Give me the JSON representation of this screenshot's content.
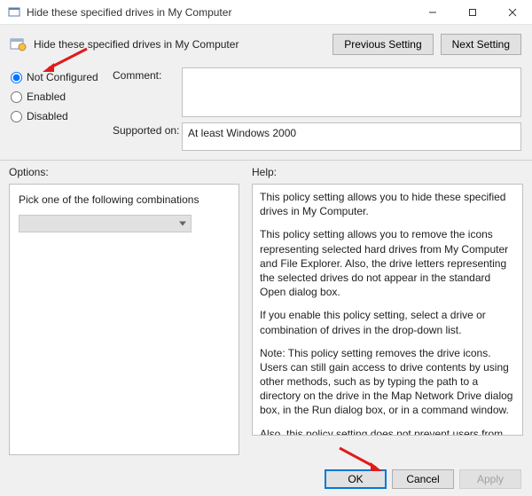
{
  "titlebar": {
    "title": "Hide these specified drives in My Computer"
  },
  "header": {
    "title": "Hide these specified drives in My Computer",
    "prev_btn": "Previous Setting",
    "next_btn": "Next Setting"
  },
  "radios": {
    "not_configured": "Not Configured",
    "enabled": "Enabled",
    "disabled": "Disabled",
    "selected": "not_configured"
  },
  "labels": {
    "comment": "Comment:",
    "supported": "Supported on:",
    "options": "Options:",
    "help": "Help:"
  },
  "comment": "",
  "supported_on": "At least Windows 2000",
  "options": {
    "label": "Pick one of the following combinations",
    "selected": ""
  },
  "help": {
    "p1": "This policy setting allows you to hide these specified drives in My Computer.",
    "p2": "This policy setting allows you to remove the icons representing selected hard drives from My Computer and File Explorer. Also, the drive letters representing the selected drives do not appear in the standard Open dialog box.",
    "p3": "If you enable this policy setting, select a drive or combination of drives in the drop-down list.",
    "p4": "Note: This policy setting removes the drive icons. Users can still gain access to drive contents by using other methods, such as by typing the path to a directory on the drive in the Map Network Drive dialog box, in the Run dialog box, or in a command window.",
    "p5": "Also, this policy setting does not prevent users from using programs to access these drives or their contents. And, it does not prevent users from using the Disk Management snap-in to view and change drive characteristics."
  },
  "footer": {
    "ok": "OK",
    "cancel": "Cancel",
    "apply": "Apply"
  }
}
